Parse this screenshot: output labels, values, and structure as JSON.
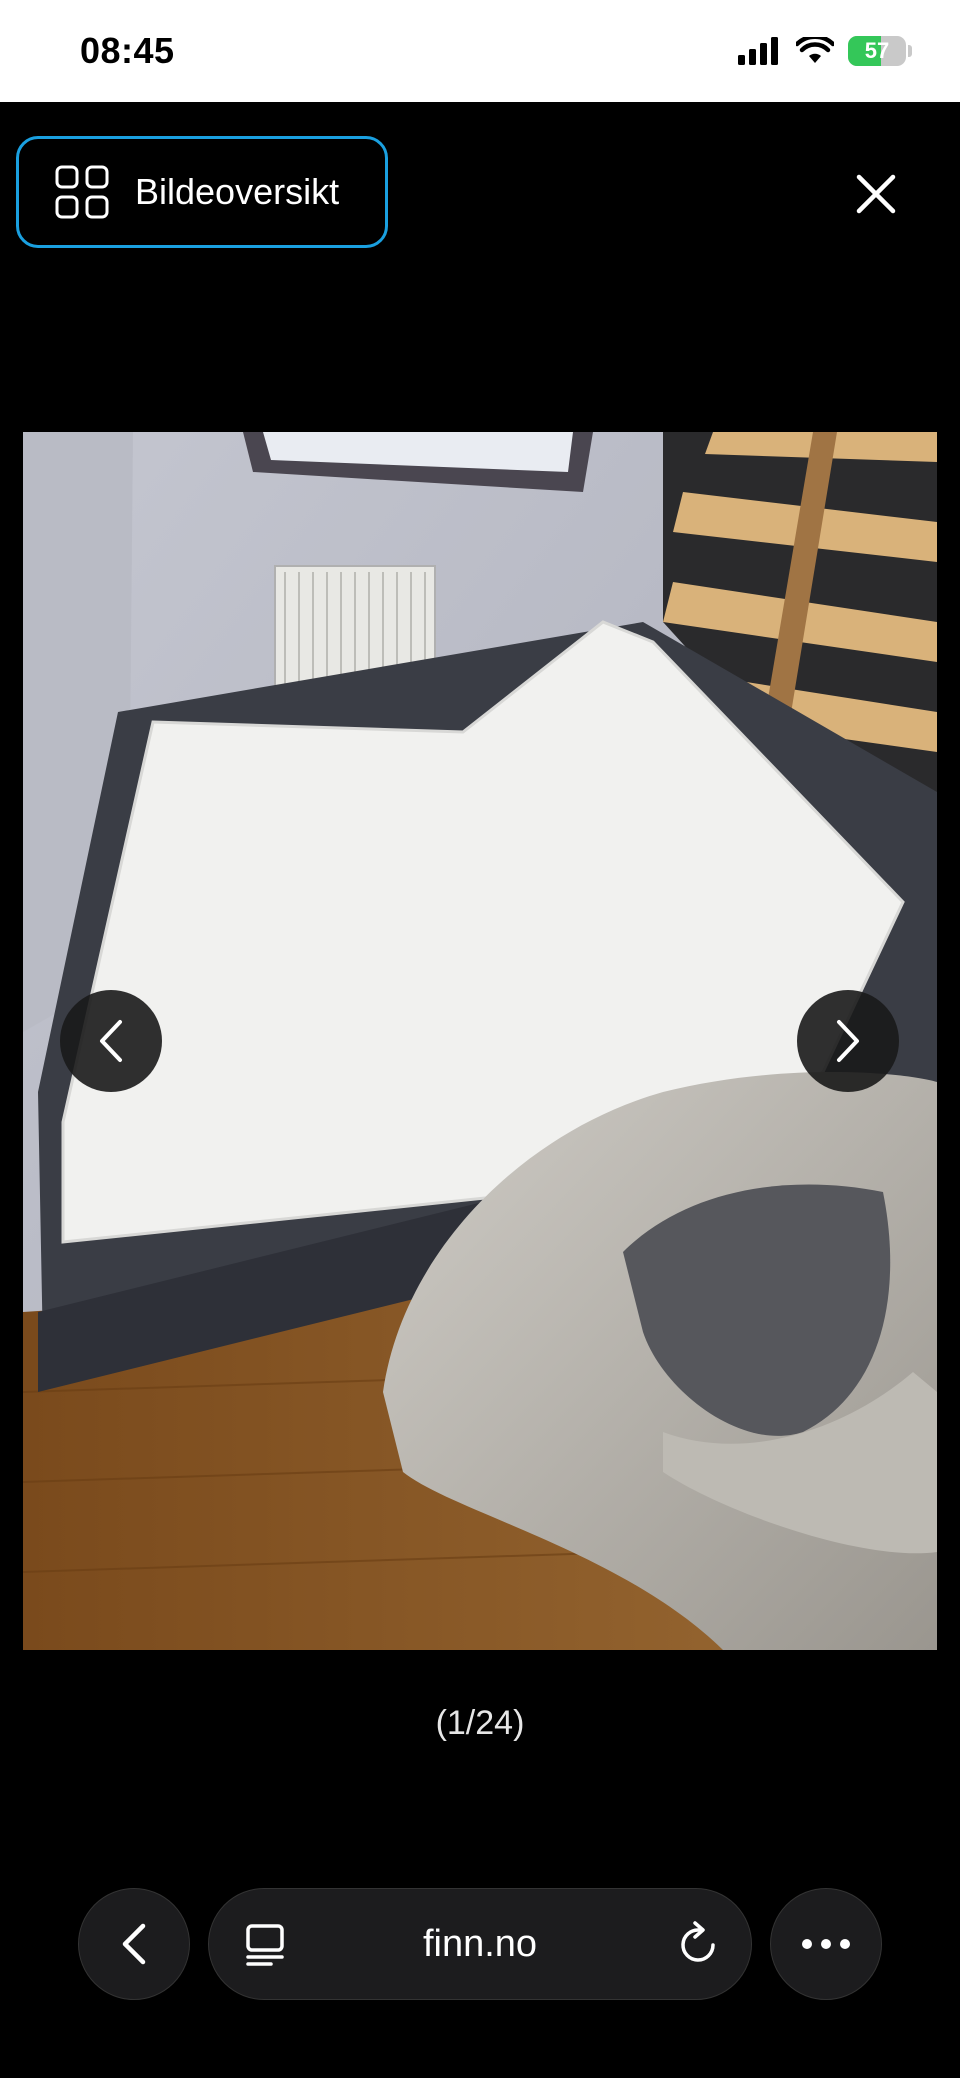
{
  "status_bar": {
    "time": "08:45",
    "battery_level": "57",
    "icons": [
      "signal-icon",
      "wifi-icon",
      "battery-icon"
    ]
  },
  "header": {
    "gallery_button_label": "Bildeoversikt",
    "gallery_icon": "grid-icon",
    "close_icon": "close-icon"
  },
  "viewer": {
    "counter": "(1/24)",
    "current_index": 1,
    "total_images": 24,
    "prev_icon": "chevron-left-icon",
    "next_icon": "chevron-right-icon"
  },
  "browser_toolbar": {
    "url": "finn.no",
    "back_icon": "chevron-left-icon",
    "reader_icon": "reader-mode-icon",
    "reload_icon": "reload-icon",
    "more_icon": "more-icon"
  },
  "colors": {
    "background": "#000000",
    "focus_outline": "#1aa0e0",
    "battery_fill": "#34c759"
  }
}
